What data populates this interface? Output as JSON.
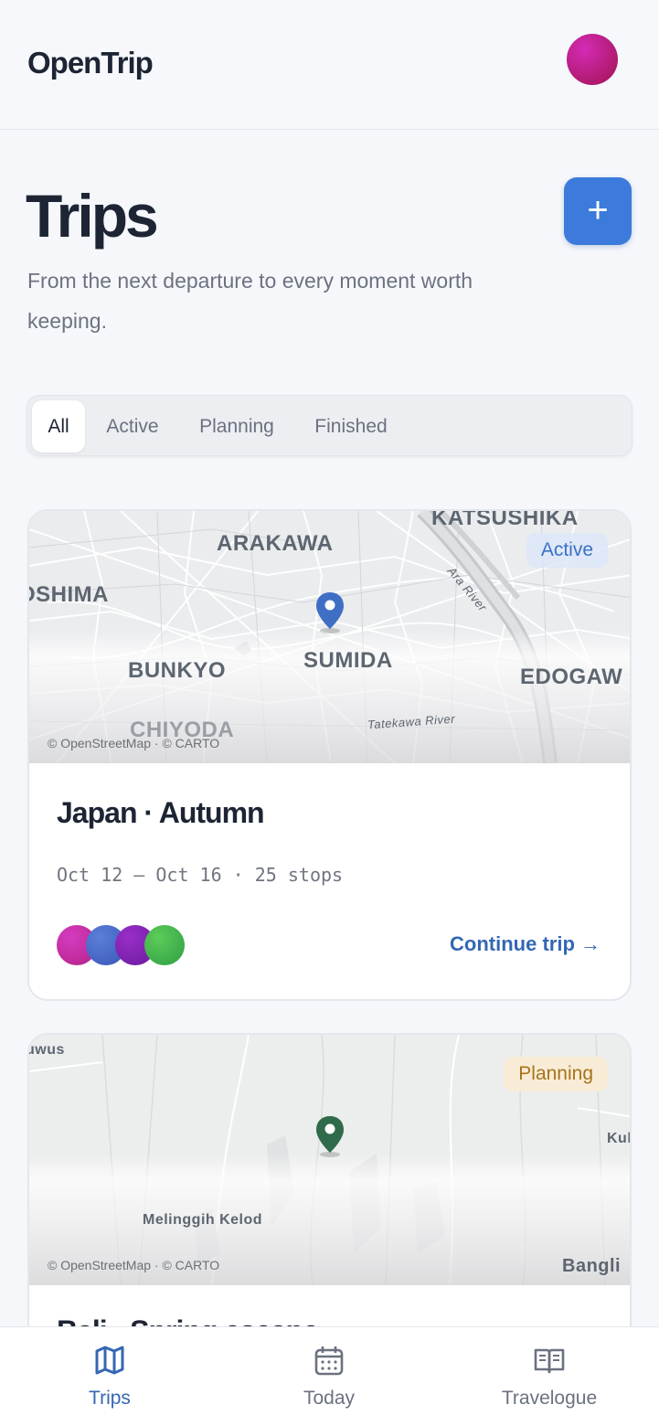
{
  "app": {
    "name": "OpenTrip"
  },
  "page": {
    "title": "Trips",
    "subtitle": "From the next departure to every moment worth keeping.",
    "add_label": "+"
  },
  "filters": [
    {
      "label": "All",
      "selected": true
    },
    {
      "label": "Active",
      "selected": false
    },
    {
      "label": "Planning",
      "selected": false
    },
    {
      "label": "Finished",
      "selected": false
    }
  ],
  "trips": [
    {
      "title": "Japan · Autumn",
      "status": "Active",
      "dates_stops": "Oct 12 — Oct 16 · 25 stops",
      "action": "Continue trip →",
      "attribution": "© OpenStreetMap · © CARTO",
      "map_labels": [
        "KATSUSHIKA",
        "ARAKAWA",
        "OSHIMA",
        "BUNKYO",
        "SUMIDA",
        "EDOGAW",
        "CHIYODA",
        "Ara River",
        "Tatekawa River"
      ],
      "pin_color": "#3f6fc4",
      "member_colors": [
        "#c42aa6",
        "#4a6fd0",
        "#7a1fb0",
        "#3bb14a"
      ]
    },
    {
      "title": "Bali · Spring escape",
      "status": "Planning",
      "attribution": "© OpenStreetMap · © CARTO",
      "map_labels": [
        "uwus",
        "Kul",
        "Melinggih Kelod",
        "Bangli"
      ],
      "pin_color": "#2f6b4a"
    }
  ],
  "nav": [
    {
      "label": "Trips",
      "icon": "map-icon",
      "current": true
    },
    {
      "label": "Today",
      "icon": "calendar-icon",
      "current": false
    },
    {
      "label": "Travelogue",
      "icon": "book-icon",
      "current": false
    }
  ],
  "colors": {
    "accent": "#3c7bdb",
    "link": "#3467b4"
  }
}
